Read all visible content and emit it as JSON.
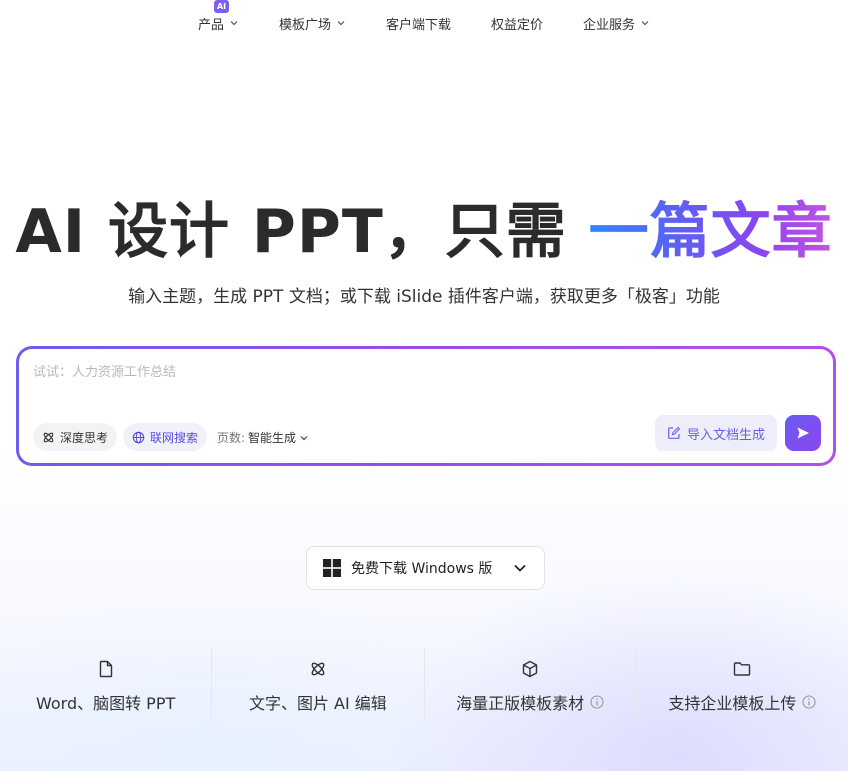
{
  "nav": {
    "items": [
      {
        "label": "产品",
        "badge": "AI",
        "has_dropdown": true
      },
      {
        "label": "模板广场",
        "has_dropdown": true
      },
      {
        "label": "客户端下载",
        "has_dropdown": false
      },
      {
        "label": "权益定价",
        "has_dropdown": false
      },
      {
        "label": "企业服务",
        "has_dropdown": true
      }
    ]
  },
  "hero": {
    "title_main": "AI 设计 PPT，只需 ",
    "title_accent": "一篇文章",
    "subtitle": "输入主题，生成 PPT 文档；或下载 iSlide 插件客户端，获取更多「极客」功能"
  },
  "prompt": {
    "placeholder": "试试：人力资源工作总结",
    "value": "",
    "deep_think_label": "深度思考",
    "web_search_label": "联网搜索",
    "pages_label": "页数:",
    "pages_value": "智能生成",
    "import_label": "导入文档生成"
  },
  "download": {
    "label": "免费下载 Windows 版"
  },
  "features": [
    {
      "text": "Word、脑图转 PPT",
      "icon": "file-icon",
      "info": false
    },
    {
      "text": "文字、图片 AI 编辑",
      "icon": "atom-icon",
      "info": false
    },
    {
      "text": "海量正版模板素材",
      "icon": "cube-icon",
      "info": true
    },
    {
      "text": "支持企业模板上传",
      "icon": "folder-icon",
      "info": true
    }
  ],
  "colors": {
    "accent_start": "#2f86f6",
    "accent_end": "#c255e0",
    "primary": "#6a5bf3"
  }
}
